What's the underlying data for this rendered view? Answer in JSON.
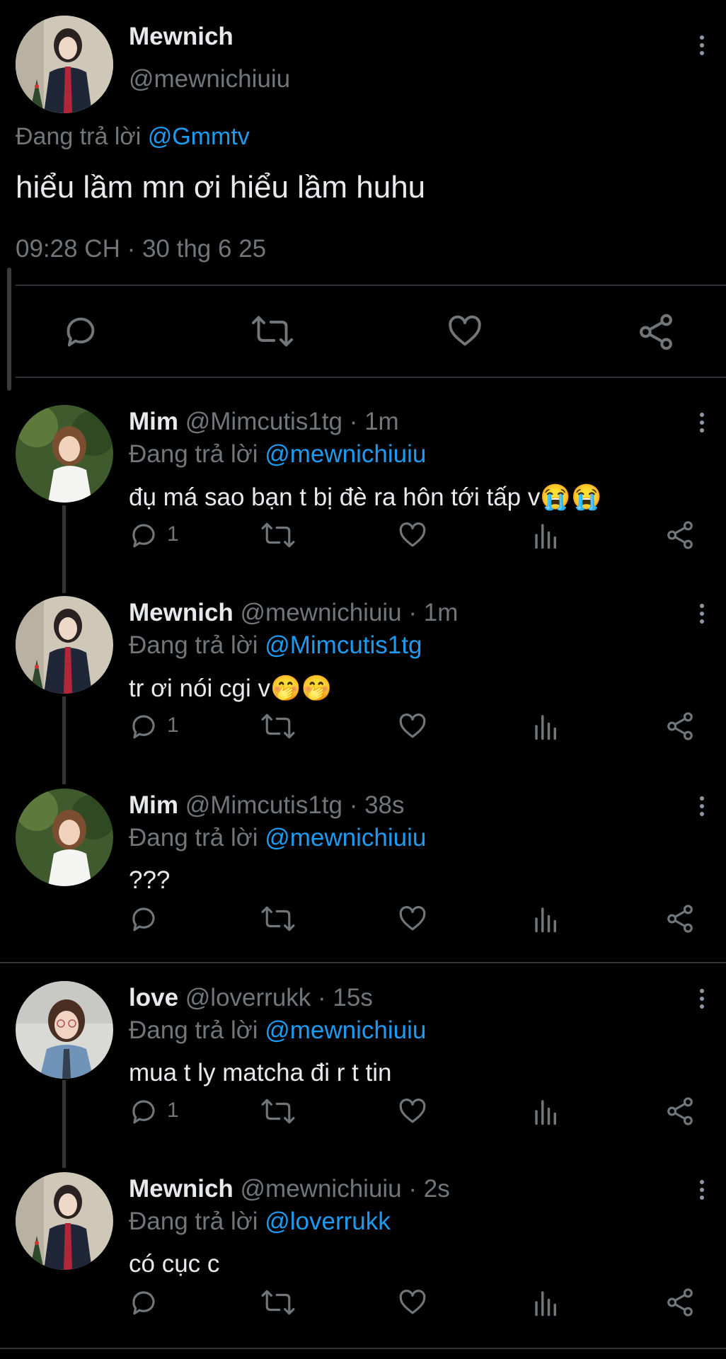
{
  "main_tweet": {
    "display_name": "Mewnich",
    "handle": "@mewnichiuiu",
    "replying_prefix": "Đang trả lời",
    "replying_to": "@Gmmtv",
    "text": "hiểu lầm mn ơi hiểu lầm huhu",
    "timestamp": "09:28 CH · 30 thg 6 25",
    "avatar_icon": "avatar-schoolgirl-photo"
  },
  "replies": [
    {
      "display_name": "Mim",
      "meta": "@Mimcutis1tg · 1m",
      "replying_prefix": "Đang trả lời",
      "replying_to": "@mewnichiuiu",
      "text": "đụ má sao bạn t bị đè ra hôn tới tấp v",
      "emoji": "😭😭",
      "reply_count": "1"
    },
    {
      "display_name": "Mewnich",
      "meta": "@mewnichiuiu · 1m",
      "replying_prefix": "Đang trả lời",
      "replying_to": "@Mimcutis1tg",
      "text": "tr ơi nói cgi v",
      "emoji": "🤭🤭",
      "reply_count": "1"
    },
    {
      "display_name": "Mim",
      "meta": "@Mimcutis1tg · 38s",
      "replying_prefix": "Đang trả lời",
      "replying_to": "@mewnichiuiu",
      "text": "???",
      "emoji": "",
      "reply_count": ""
    },
    {
      "display_name": "love",
      "meta": "@loverrukk · 15s",
      "replying_prefix": "Đang trả lời",
      "replying_to": "@mewnichiuiu",
      "text": "mua t ly matcha đi r t tin",
      "emoji": "",
      "reply_count": "1"
    },
    {
      "display_name": "Mewnich",
      "meta": "@mewnichiuiu · 2s",
      "replying_prefix": "Đang trả lời",
      "replying_to": "@loverrukk",
      "text": "có cục c",
      "emoji": "",
      "reply_count": ""
    }
  ],
  "colors": {
    "background": "#000000",
    "text": "#e7e9ea",
    "muted": "#71767b",
    "link": "#1d9bf0",
    "divider": "#2f3336"
  }
}
